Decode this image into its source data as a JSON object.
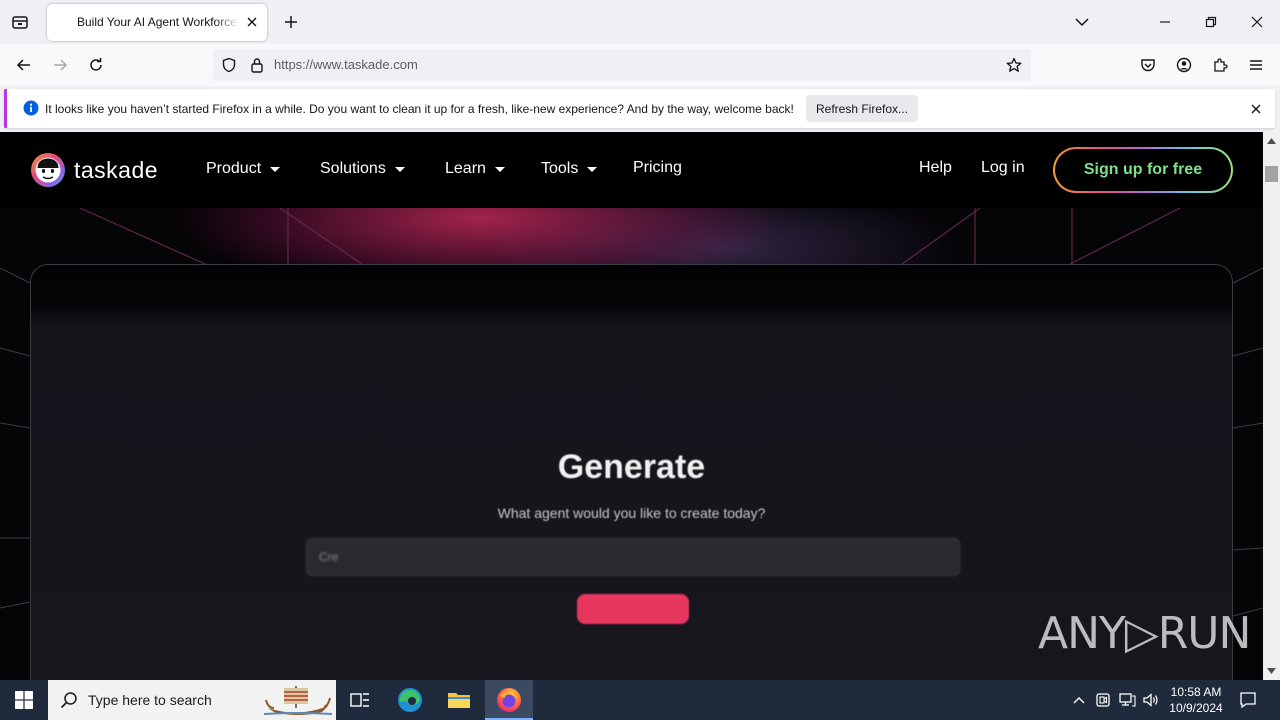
{
  "browser": {
    "active_tab_title": "Build Your AI Agent Workforce",
    "url": "https://www.taskade.com"
  },
  "notification": {
    "message": "It looks like you haven’t started Firefox in a while. Do you want to clean it up for a fresh, like-new experience? And by the way, welcome back!",
    "button_label": "Refresh Firefox..."
  },
  "site": {
    "brand": "taskade",
    "menu": [
      {
        "label": "Product",
        "dropdown": true
      },
      {
        "label": "Solutions",
        "dropdown": true
      },
      {
        "label": "Learn",
        "dropdown": true
      },
      {
        "label": "Tools",
        "dropdown": true
      },
      {
        "label": "Pricing",
        "dropdown": false
      }
    ],
    "help_label": "Help",
    "login_label": "Log in",
    "signup_label": "Sign up for free",
    "hero": {
      "title": "Generate",
      "subtitle": "What agent would you like to create today?",
      "input_placeholder": "Cre"
    }
  },
  "watermark": "ANY▷RUN",
  "taskbar": {
    "search_placeholder": "Type here to search",
    "time": "10:58 AM",
    "date": "10/9/2024"
  },
  "colors": {
    "notification_accent": "#b833e1",
    "signup_text": "#7fe08a",
    "generate_button": "#e8375f",
    "taskbar_bg": "#1f2b3d"
  }
}
